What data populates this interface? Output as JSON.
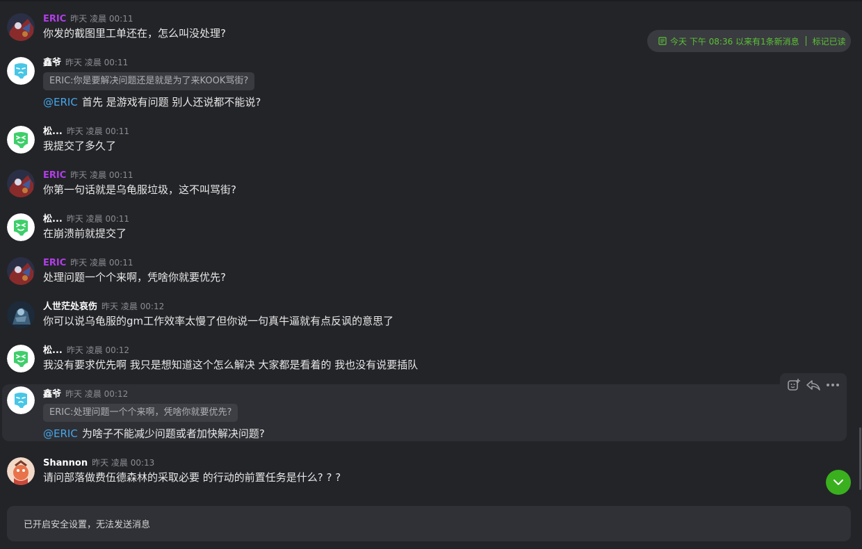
{
  "messages": [
    {
      "name": "ERIC",
      "time": "昨天 凌晨 00:11",
      "text": "你发的截图里工单还在，怎么叫没处理?"
    },
    {
      "name": "鑫爷",
      "time": "昨天 凌晨 00:11",
      "quote": "ERIC:你是要解决问题还是就是为了来KOOK骂街?",
      "mention": "@ERIC",
      "text": "首先 是游戏有问题 别人还说都不能说?"
    },
    {
      "name": "松...",
      "time": "昨天 凌晨 00:11",
      "text": "我提交了多久了"
    },
    {
      "name": "ERIC",
      "time": "昨天 凌晨 00:11",
      "text": "你第一句话就是乌龟服垃圾，这不叫骂街?"
    },
    {
      "name": "松...",
      "time": "昨天 凌晨 00:11",
      "text": "在崩溃前就提交了"
    },
    {
      "name": "ERIC",
      "time": "昨天 凌晨 00:11",
      "text": "处理问题一个个来啊，凭啥你就要优先?"
    },
    {
      "name": "人世茫处哀伤",
      "time": "昨天 凌晨 00:12",
      "text": "你可以说乌龟服的gm工作效率太慢了但你说一句真牛逼就有点反讽的意思了"
    },
    {
      "name": "松...",
      "time": "昨天 凌晨 00:12",
      "text": "我没有要求优先啊 我只是想知道这个怎么解决 大家都是看着的 我也没有说要插队"
    },
    {
      "name": "鑫爷",
      "time": "昨天 凌晨 00:12",
      "quote": "ERIC:处理问题一个个来啊，凭啥你就要优先?",
      "mention": "@ERIC",
      "text": "为啥子不能减少问题或者加快解决问题?"
    },
    {
      "name": "Shannon",
      "time": "昨天 凌晨 00:13",
      "text": "请问部落做费伍德森林的采取必要 的行动的前置任务是什么? ? ?"
    }
  ],
  "new_message_bar": {
    "text": "今天 下午 08:36 以来有1条新消息",
    "mark_read": "标记已读"
  },
  "composer": {
    "text": "已开启安全设置，无法发送消息"
  },
  "colors": {
    "background": "#232428",
    "accent": "#5bc236",
    "eric_name": "#b13ee8",
    "mention": "#45a6ec"
  },
  "icons": {
    "toolbar": [
      "add-reaction-icon",
      "reply-icon",
      "more-icon"
    ],
    "scroll": "chevron-down-icon"
  }
}
